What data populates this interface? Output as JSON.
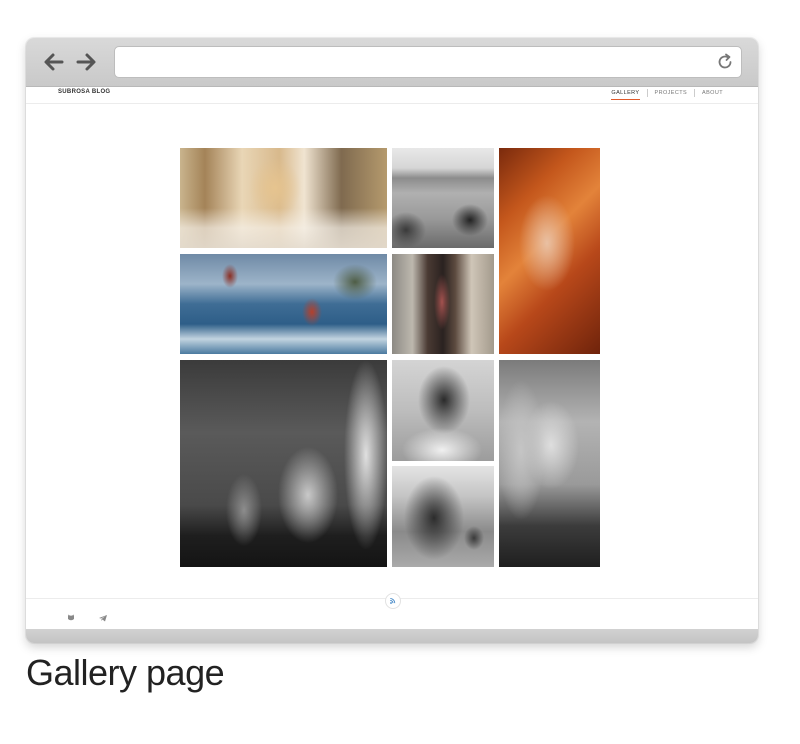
{
  "site": {
    "brand": "SUBROSA BLOG",
    "menu": [
      {
        "label": "GALLERY",
        "active": true
      },
      {
        "label": "PROJECTS",
        "active": false
      },
      {
        "label": "ABOUT",
        "active": false
      }
    ]
  },
  "browser": {
    "url": "",
    "icons": [
      "arrow-left-icon",
      "arrow-right-icon",
      "reload-icon"
    ]
  },
  "gallery": {
    "photos": [
      {
        "name": "photo-woman-blonde-doorway"
      },
      {
        "name": "photo-beach-horses-bw"
      },
      {
        "name": "photo-redhead-portrait"
      },
      {
        "name": "photo-stilt-fishermen"
      },
      {
        "name": "photo-butcher-doorway"
      },
      {
        "name": "photo-cat-and-beagle"
      },
      {
        "name": "photo-man-pointing-bw"
      },
      {
        "name": "photo-legs-and-dog-bw"
      },
      {
        "name": "photo-blonde-portrait-bw"
      }
    ]
  },
  "footer": {
    "icons": [
      "rss-icon",
      "github-icon",
      "telegram-icon"
    ]
  },
  "caption": "Gallery page"
}
